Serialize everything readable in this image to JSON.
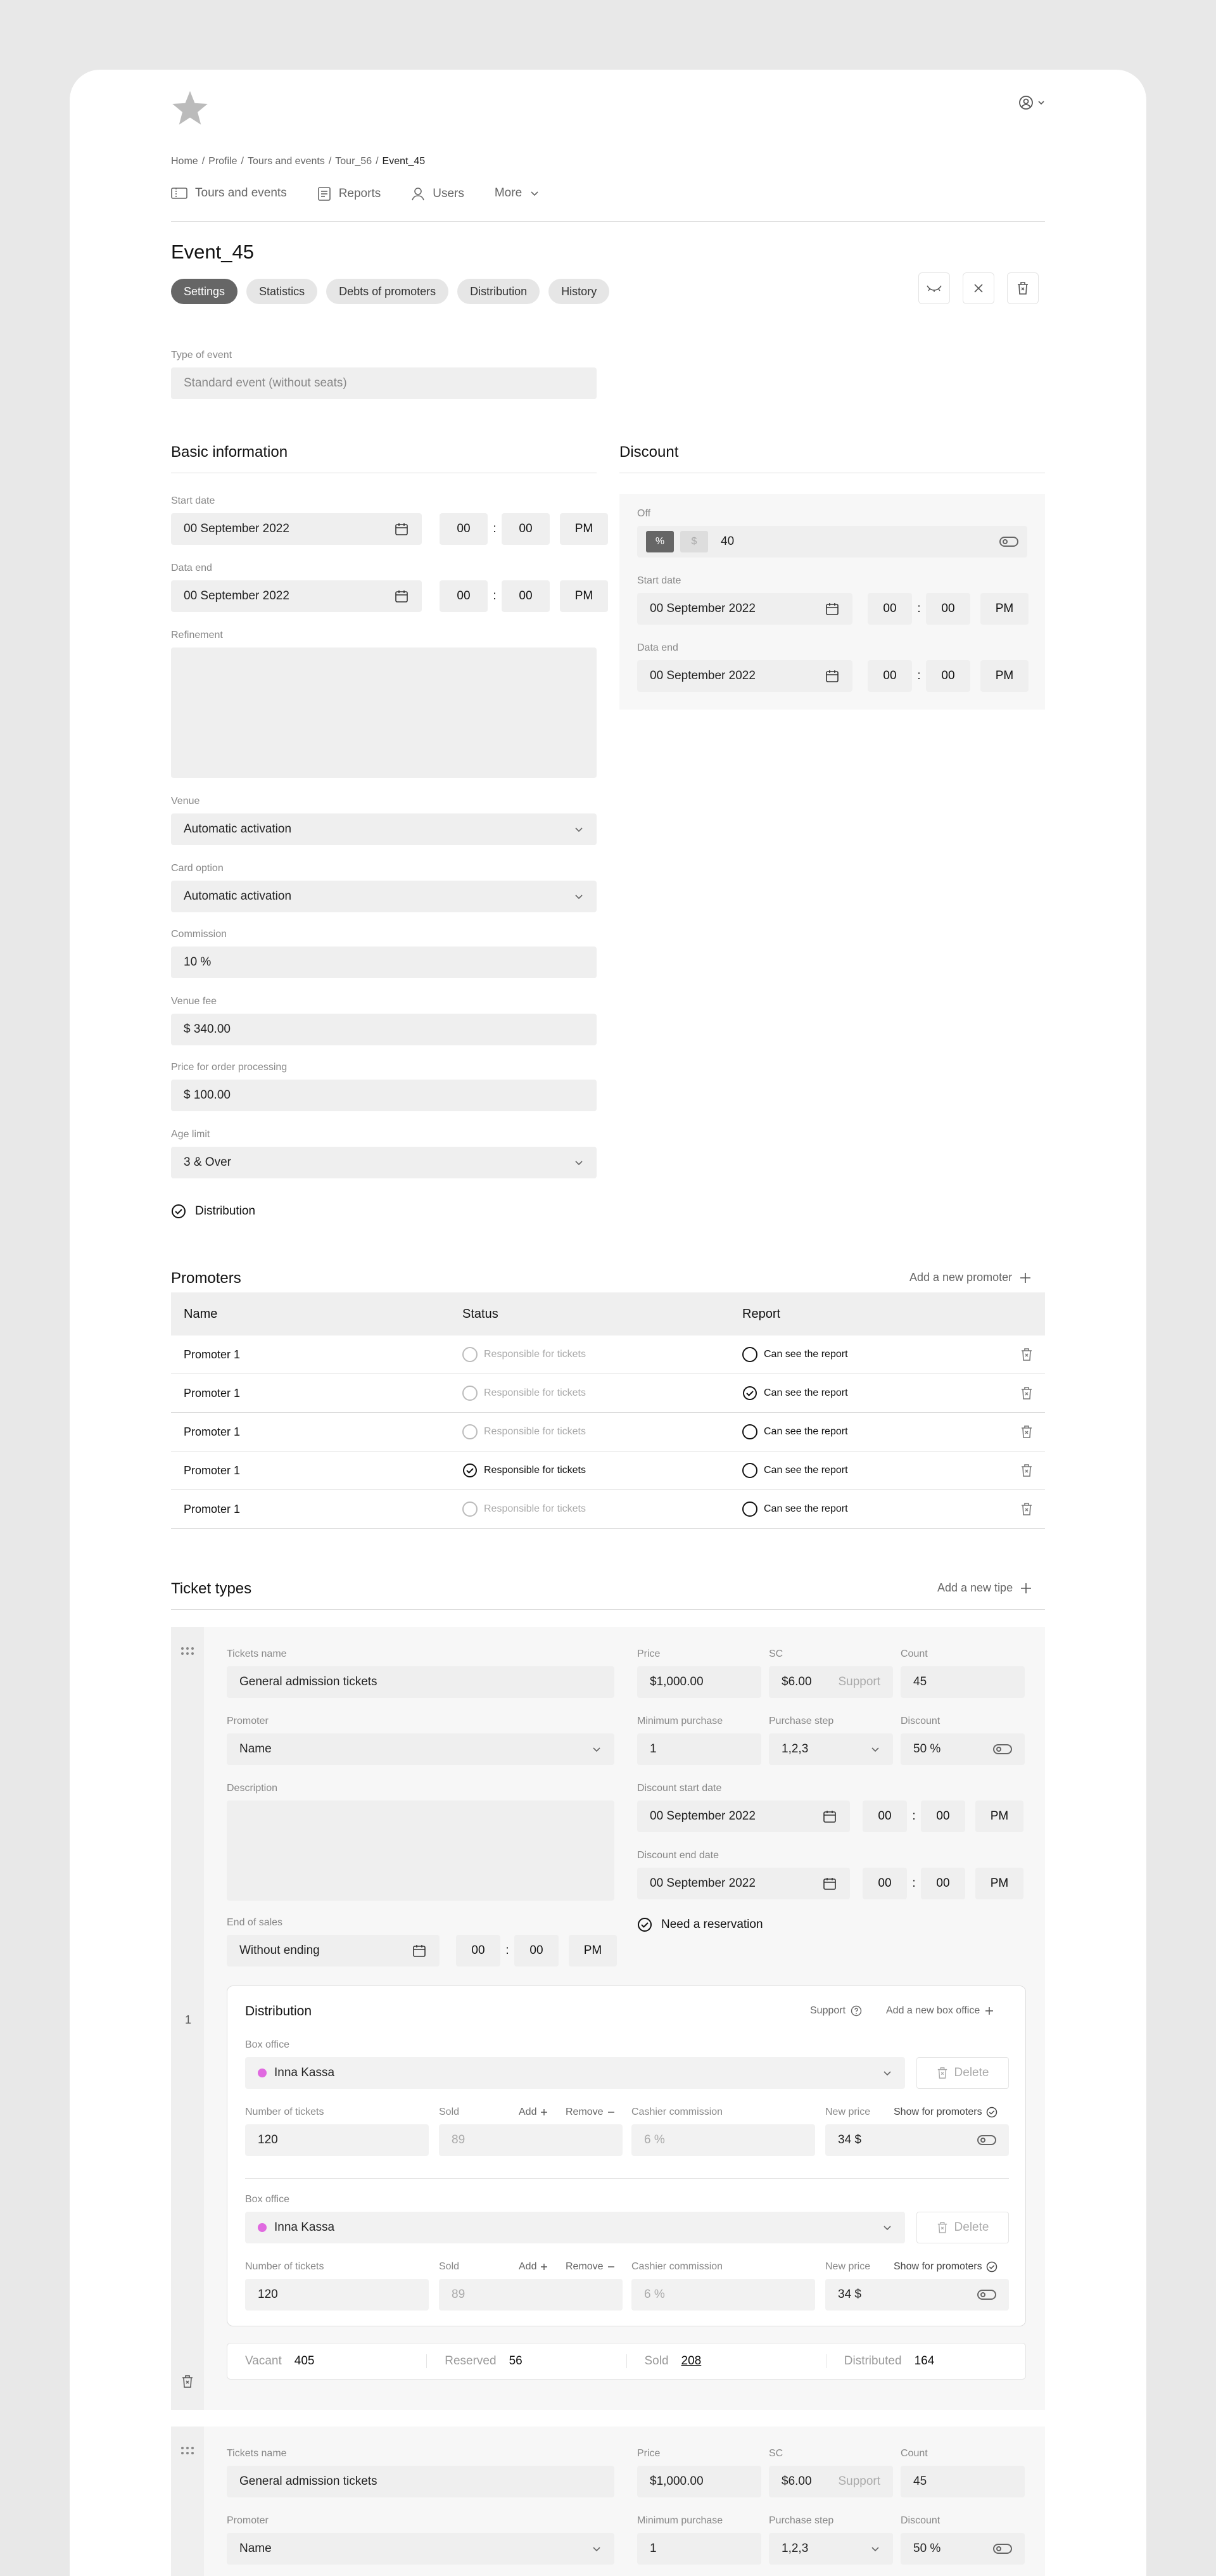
{
  "header": {
    "breadcrumbs": [
      "Home",
      "Profile",
      "Tours and events",
      "Tour_56",
      "Event_45"
    ],
    "nav": [
      {
        "label": "Tours and events",
        "icon": "ticket-icon"
      },
      {
        "label": "Reports",
        "icon": "report-icon"
      },
      {
        "label": "Users",
        "icon": "user-icon"
      },
      {
        "label": "More",
        "icon": "chevron-down-icon"
      }
    ]
  },
  "event": {
    "title": "Event_45",
    "tabs": [
      "Settings",
      "Statistics",
      "Debts of promoters",
      "Distribution",
      "History"
    ],
    "type_label": "Type of event",
    "type_value": "Standard event (without seats)"
  },
  "basic": {
    "heading": "Basic information",
    "start_label": "Start date",
    "start_date": "00 September 2022",
    "end_label": "Data end",
    "end_date": "00 September 2022",
    "hh": "00",
    "mm": "00",
    "ampm": "PM",
    "refinement_label": "Refinement",
    "venue_label": "Venue",
    "venue_value": "Automatic activation",
    "card_label": "Card option",
    "card_value": "Automatic activation",
    "commission_label": "Commission",
    "commission_value": "10 %",
    "venue_fee_label": "Venue fee",
    "venue_fee_value": "$ 340.00",
    "order_label": "Price for order processing",
    "order_value": "$ 100.00",
    "age_label": "Age limit",
    "age_value": "3 & Over",
    "distribution_label": "Distribution"
  },
  "discount": {
    "heading": "Discount",
    "off_label": "Off",
    "pct": "%",
    "usd": "$",
    "off_value": "40",
    "start_label": "Start date",
    "start_date": "00 September 2022",
    "end_label": "Data end",
    "end_date": "00 September 2022"
  },
  "promoters": {
    "heading": "Promoters",
    "add_label": "Add a new promoter",
    "columns": [
      "Name",
      "Status",
      "Report"
    ],
    "rows": [
      {
        "name": "Promoter 1",
        "status": "Responsible for tickets",
        "report": "Can see the report",
        "status_on": false,
        "report_on": false
      },
      {
        "name": "Promoter 1",
        "status": "Responsible for tickets",
        "report": "Can see the report",
        "status_on": false,
        "report_on": true
      },
      {
        "name": "Promoter 1",
        "status": "Responsible for tickets",
        "report": "Can see the report",
        "status_on": false,
        "report_on": false
      },
      {
        "name": "Promoter 1",
        "status": "Responsible for tickets",
        "report": "Can see the report",
        "status_on": true,
        "report_on": false
      },
      {
        "name": "Promoter 1",
        "status": "Responsible for tickets",
        "report": "Can see the report",
        "status_on": false,
        "report_on": false
      }
    ]
  },
  "tickets": {
    "heading": "Ticket types",
    "add_label": "Add a new tipe",
    "index": "1",
    "name_label": "Tickets name",
    "name_value": "General admission tickets",
    "price_label": "Price",
    "price_value": "$1,000.00",
    "sc_label": "SC",
    "sc_value": "$6.00",
    "sc_hint": "Support",
    "count_label": "Count",
    "count_value": "45",
    "promoter_label": "Promoter",
    "promoter_value": "Name",
    "min_label": "Minimum purchase",
    "min_value": "1",
    "step_label": "Purchase step",
    "step_value": "1,2,3",
    "discount_label": "Discount",
    "discount_value": "50 %",
    "desc_label": "Description",
    "dstart_label": "Discount start date",
    "dstart_value": "00 September 2022",
    "dend_label": "Discount end date",
    "dend_value": "00 September 2022",
    "reservation_label": "Need a reservation",
    "end_sales_label": "End of sales",
    "end_sales_value": "Without ending",
    "distribution": {
      "heading": "Distribution",
      "support": "Support",
      "add_box": "Add a new box office",
      "boxes": [
        {
          "box_label": "Box office",
          "box_value": "Inna Kassa",
          "delete": "Delete",
          "num_label": "Number of tickets",
          "num_value": "120",
          "sold_label": "Sold",
          "sold_value": "89",
          "add": "Add",
          "remove": "Remove",
          "cc_label": "Cashier commission",
          "cc_value": "6 %",
          "np_label": "New price",
          "np_value": "34 $",
          "show_label": "Show for promoters"
        },
        {
          "box_label": "Box office",
          "box_value": "Inna Kassa",
          "delete": "Delete",
          "num_label": "Number of tickets",
          "num_value": "120",
          "sold_label": "Sold",
          "sold_value": "89",
          "add": "Add",
          "remove": "Remove",
          "cc_label": "Cashier commission",
          "cc_value": "6 %",
          "np_label": "New price",
          "np_value": "34 $",
          "show_label": "Show for promoters"
        }
      ]
    },
    "summary": [
      {
        "label": "Vacant",
        "value": "405"
      },
      {
        "label": "Reserved",
        "value": "56"
      },
      {
        "label": "Sold",
        "value": "208"
      },
      {
        "label": "Distributed",
        "value": "164"
      }
    ]
  }
}
